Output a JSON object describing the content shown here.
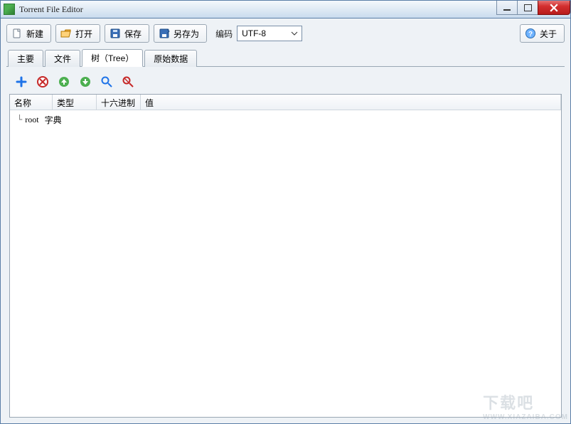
{
  "window": {
    "title": "Torrent File Editor"
  },
  "toolbar": {
    "new_label": "新建",
    "open_label": "打开",
    "save_label": "保存",
    "save_as_label": "另存为",
    "encoding_label": "编码",
    "encoding_value": "UTF-8",
    "about_label": "关于"
  },
  "tabs": {
    "main": "主要",
    "files": "文件",
    "tree": "树（Tree）",
    "raw": "原始数据",
    "active": "tree"
  },
  "tree_toolbar": {
    "add": "add-icon",
    "delete": "delete-icon",
    "up": "move-up-icon",
    "down": "move-down-icon",
    "find": "find-icon",
    "find_replace": "find-replace-icon"
  },
  "tree_grid": {
    "columns": {
      "name": "名称",
      "type": "类型",
      "hex": "十六进制",
      "value": "值"
    },
    "rows": [
      {
        "name": "root",
        "type": "字典",
        "hex": "",
        "value": ""
      }
    ]
  },
  "watermark": {
    "big": "下载吧",
    "small": "WWW.XIAZAIBA.COM"
  }
}
